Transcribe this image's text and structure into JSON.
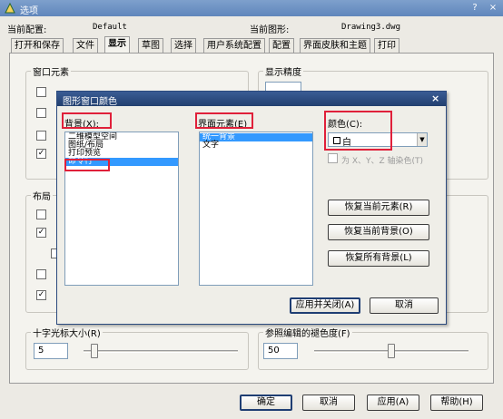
{
  "window": {
    "title": "选项",
    "help": "?",
    "close": "×"
  },
  "header": {
    "profile_label": "当前配置:",
    "profile_value": "Default",
    "drawing_label": "当前图形:",
    "drawing_value": "Drawing3.dwg"
  },
  "tabs": [
    {
      "label": "打开和保存"
    },
    {
      "label": "文件"
    },
    {
      "label": "显示"
    },
    {
      "label": "草图"
    },
    {
      "label": "选择"
    },
    {
      "label": "用户系统配置"
    },
    {
      "label": "配置"
    },
    {
      "label": "界面皮肤和主题"
    },
    {
      "label": "打印"
    }
  ],
  "panel": {
    "window_elements_title": "窗口元素",
    "display_precision_title": "显示精度",
    "layout_title": "布局",
    "crosshair_title": "十字光标大小(R)",
    "crosshair_value": "5",
    "crosshair_level": 0.05,
    "refedit_title": "参照编辑的褪色度(F)",
    "refedit_value": "50",
    "refedit_level": 0.5
  },
  "modal": {
    "title": "图形窗口颜色",
    "close": "×",
    "background_label": "背景(X):",
    "background_items": [
      {
        "label": "二维模型空间"
      },
      {
        "label": "图纸/布局"
      },
      {
        "label": "打印预览"
      },
      {
        "label": "命令行"
      }
    ],
    "background_selected": "命令行",
    "element_label": "界面元素(E)",
    "element_items": [
      {
        "label": "统一背景"
      },
      {
        "label": "文字"
      }
    ],
    "color_label": "颜色(C):",
    "color_value": "白",
    "tint_label": "为 X、Y、Z 轴染色(T)",
    "restore_element": "恢复当前元素(R)",
    "restore_context": "恢复当前背景(O)",
    "restore_all": "恢复所有背景(L)",
    "apply_close": "应用并关闭(A)",
    "cancel": "取消",
    "highlight_color": "#e0203a"
  },
  "footer": {
    "ok": "确定",
    "cancel": "取消",
    "apply": "应用(A)",
    "help": "帮助(H)"
  }
}
